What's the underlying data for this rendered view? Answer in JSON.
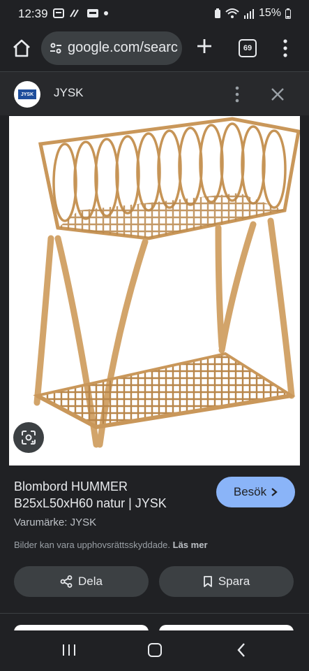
{
  "status_bar": {
    "time": "12:39",
    "battery": "15%"
  },
  "browser": {
    "url": "google.com/searc",
    "tab_count": "69"
  },
  "site_header": {
    "site_name": "JYSK",
    "logo_text": "JYSK"
  },
  "result": {
    "title": "Blombord HUMMER B25xL50xH60 natur | JYSK",
    "brand": "Varumärke: JYSK",
    "copyright_notice": "Bilder kan vara upphovsrättsskyddade.",
    "learn_more": "Läs mer",
    "visit_label": "Besök",
    "share_label": "Dela",
    "save_label": "Spara"
  },
  "colors": {
    "accent": "#8ab4f8",
    "background": "#202124",
    "chip": "#3c4043"
  }
}
